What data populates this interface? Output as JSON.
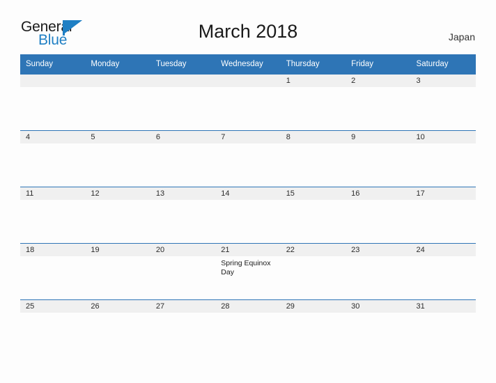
{
  "brand": {
    "name_top": "General",
    "name_bottom": "Blue",
    "flag_icon": "flag-triangle-icon",
    "color_dark": "#1a1a1a",
    "color_blue": "#1f7fc4"
  },
  "header": {
    "title": "March 2018",
    "country": "Japan"
  },
  "theme": {
    "header_blue": "#2e75b6",
    "band_gray": "#f0f0f0",
    "page_bg": "#fdfdfd",
    "text": "#2b2b2b"
  },
  "calendar": {
    "weekday_headers": [
      "Sunday",
      "Monday",
      "Tuesday",
      "Wednesday",
      "Thursday",
      "Friday",
      "Saturday"
    ],
    "weeks": [
      [
        {
          "day": "",
          "events": []
        },
        {
          "day": "",
          "events": []
        },
        {
          "day": "",
          "events": []
        },
        {
          "day": "",
          "events": []
        },
        {
          "day": "1",
          "events": []
        },
        {
          "day": "2",
          "events": []
        },
        {
          "day": "3",
          "events": []
        }
      ],
      [
        {
          "day": "4",
          "events": []
        },
        {
          "day": "5",
          "events": []
        },
        {
          "day": "6",
          "events": []
        },
        {
          "day": "7",
          "events": []
        },
        {
          "day": "8",
          "events": []
        },
        {
          "day": "9",
          "events": []
        },
        {
          "day": "10",
          "events": []
        }
      ],
      [
        {
          "day": "11",
          "events": []
        },
        {
          "day": "12",
          "events": []
        },
        {
          "day": "13",
          "events": []
        },
        {
          "day": "14",
          "events": []
        },
        {
          "day": "15",
          "events": []
        },
        {
          "day": "16",
          "events": []
        },
        {
          "day": "17",
          "events": []
        }
      ],
      [
        {
          "day": "18",
          "events": []
        },
        {
          "day": "19",
          "events": []
        },
        {
          "day": "20",
          "events": []
        },
        {
          "day": "21",
          "events": [
            "Spring Equinox Day"
          ]
        },
        {
          "day": "22",
          "events": []
        },
        {
          "day": "23",
          "events": []
        },
        {
          "day": "24",
          "events": []
        }
      ],
      [
        {
          "day": "25",
          "events": []
        },
        {
          "day": "26",
          "events": []
        },
        {
          "day": "27",
          "events": []
        },
        {
          "day": "28",
          "events": []
        },
        {
          "day": "29",
          "events": []
        },
        {
          "day": "30",
          "events": []
        },
        {
          "day": "31",
          "events": []
        }
      ]
    ]
  }
}
